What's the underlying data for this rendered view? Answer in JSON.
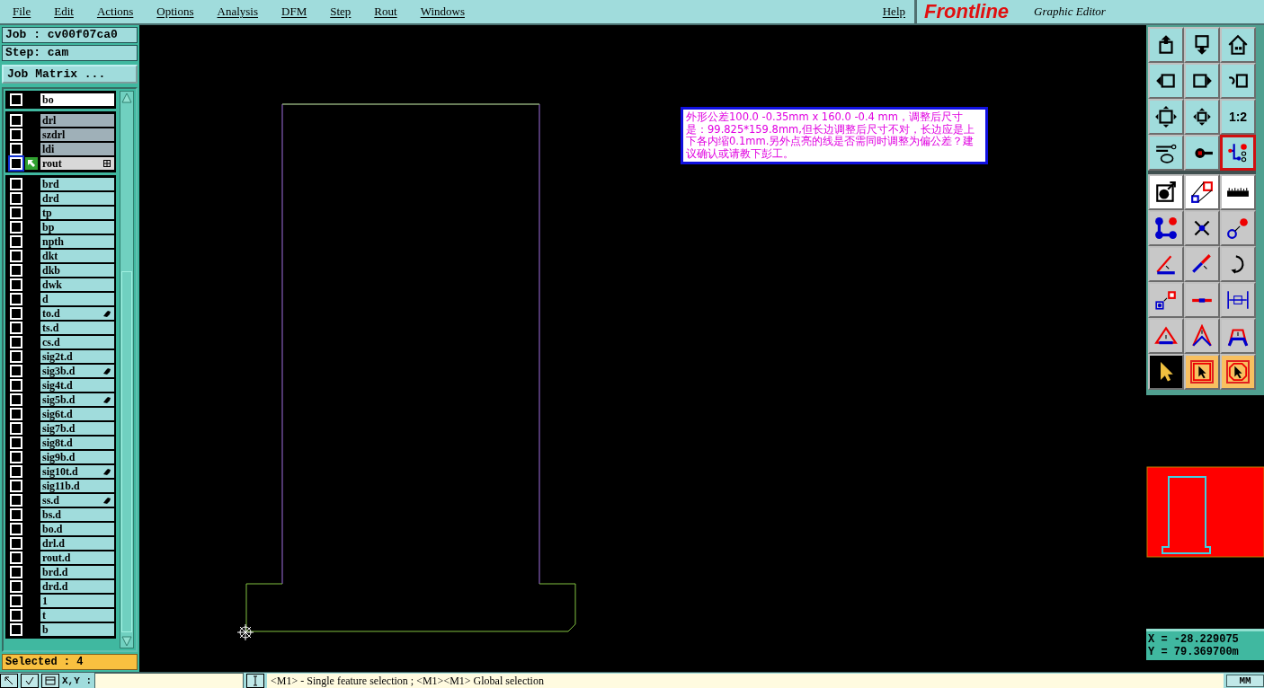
{
  "menu_bar": {
    "items": [
      {
        "label": "File"
      },
      {
        "label": "Edit"
      },
      {
        "label": "Actions"
      },
      {
        "label": "Options"
      },
      {
        "label": "Analysis"
      },
      {
        "label": "DFM"
      },
      {
        "label": "Step"
      },
      {
        "label": "Rout"
      },
      {
        "label": "Windows"
      }
    ],
    "help": "Help"
  },
  "logo": {
    "name": "Frontline",
    "subtitle": "Graphic Editor"
  },
  "job_panel": {
    "job": "Job : cv00f07ca0",
    "step": "Step: cam",
    "matrix_button": "Job Matrix ...",
    "selected_count": "Selected : 4",
    "layer_groups": [
      {
        "layers": [
          {
            "name": "bo",
            "color": "#ffffff",
            "active": false,
            "affected": false,
            "expandable": false
          }
        ]
      },
      {
        "layers": [
          {
            "name": "drl",
            "color": "#9fb0b8",
            "active": false,
            "affected": false,
            "expandable": false
          },
          {
            "name": "szdrl",
            "color": "#9fb0b8",
            "active": false,
            "affected": false,
            "expandable": false
          },
          {
            "name": "ldi",
            "color": "#9fb0b8",
            "active": false,
            "affected": false,
            "expandable": false
          },
          {
            "name": "rout",
            "color": "#d8d8d8",
            "active": true,
            "affected": false,
            "expandable": true
          }
        ]
      },
      {
        "layers": [
          {
            "name": "brd",
            "color": "#a0dcdc",
            "active": false,
            "affected": false,
            "expandable": false
          },
          {
            "name": "drd",
            "color": "#a0dcdc",
            "active": false,
            "affected": false,
            "expandable": false
          },
          {
            "name": "tp",
            "color": "#a0dcdc",
            "active": false,
            "affected": false,
            "expandable": false
          },
          {
            "name": "bp",
            "color": "#a0dcdc",
            "active": false,
            "affected": false,
            "expandable": false
          },
          {
            "name": "npth",
            "color": "#a0dcdc",
            "active": false,
            "affected": false,
            "expandable": false
          },
          {
            "name": "dkt",
            "color": "#a0dcdc",
            "active": false,
            "affected": false,
            "expandable": false
          },
          {
            "name": "dkb",
            "color": "#a0dcdc",
            "active": false,
            "affected": false,
            "expandable": false
          },
          {
            "name": "dwk",
            "color": "#a0dcdc",
            "active": false,
            "affected": false,
            "expandable": false
          },
          {
            "name": "d",
            "color": "#a0dcdc",
            "active": false,
            "affected": false,
            "expandable": false
          },
          {
            "name": "to.d",
            "color": "#a0dcdc",
            "active": false,
            "affected": true,
            "expandable": false
          },
          {
            "name": "ts.d",
            "color": "#a0dcdc",
            "active": false,
            "affected": false,
            "expandable": false
          },
          {
            "name": "cs.d",
            "color": "#a0dcdc",
            "active": false,
            "affected": false,
            "expandable": false
          },
          {
            "name": "sig2t.d",
            "color": "#a0dcdc",
            "active": false,
            "affected": false,
            "expandable": false
          },
          {
            "name": "sig3b.d",
            "color": "#a0dcdc",
            "active": false,
            "affected": true,
            "expandable": false
          },
          {
            "name": "sig4t.d",
            "color": "#a0dcdc",
            "active": false,
            "affected": false,
            "expandable": false
          },
          {
            "name": "sig5b.d",
            "color": "#a0dcdc",
            "active": false,
            "affected": true,
            "expandable": false
          },
          {
            "name": "sig6t.d",
            "color": "#a0dcdc",
            "active": false,
            "affected": false,
            "expandable": false
          },
          {
            "name": "sig7b.d",
            "color": "#a0dcdc",
            "active": false,
            "affected": false,
            "expandable": false
          },
          {
            "name": "sig8t.d",
            "color": "#a0dcdc",
            "active": false,
            "affected": false,
            "expandable": false
          },
          {
            "name": "sig9b.d",
            "color": "#a0dcdc",
            "active": false,
            "affected": false,
            "expandable": false
          },
          {
            "name": "sig10t.d",
            "color": "#a0dcdc",
            "active": false,
            "affected": true,
            "expandable": false
          },
          {
            "name": "sig11b.d",
            "color": "#a0dcdc",
            "active": false,
            "affected": false,
            "expandable": false
          },
          {
            "name": "ss.d",
            "color": "#a0dcdc",
            "active": false,
            "affected": true,
            "expandable": false
          },
          {
            "name": "bs.d",
            "color": "#a0dcdc",
            "active": false,
            "affected": false,
            "expandable": false
          },
          {
            "name": "bo.d",
            "color": "#a0dcdc",
            "active": false,
            "affected": false,
            "expandable": false
          },
          {
            "name": "drl.d",
            "color": "#a0dcdc",
            "active": false,
            "affected": false,
            "expandable": false
          },
          {
            "name": "rout.d",
            "color": "#a0dcdc",
            "active": false,
            "affected": false,
            "expandable": false
          },
          {
            "name": "brd.d",
            "color": "#a0dcdc",
            "active": false,
            "affected": false,
            "expandable": false
          },
          {
            "name": "drd.d",
            "color": "#a0dcdc",
            "active": false,
            "affected": false,
            "expandable": false
          },
          {
            "name": "1",
            "color": "#a0dcdc",
            "active": false,
            "affected": false,
            "expandable": false
          },
          {
            "name": "t",
            "color": "#a0dcdc",
            "active": false,
            "affected": false,
            "expandable": false
          },
          {
            "name": "b",
            "color": "#a0dcdc",
            "active": false,
            "affected": false,
            "expandable": false
          }
        ]
      }
    ]
  },
  "canvas": {
    "note": "外形公差100.0 -0.35mm x 160.0 -0.4 mm，调整后尺寸是：99.825*159.8mm,但长边调整后尺寸不对，长边应是上下各内缩0.1mm.另外点亮的线是否需同时调整为偏公差？建议确认或请教下彭工。"
  },
  "toolbar": {
    "buttons": [
      {
        "kind": "view",
        "selected": false
      },
      {
        "kind": "view",
        "selected": false
      },
      {
        "kind": "view",
        "selected": false
      },
      {
        "kind": "view",
        "selected": false
      },
      {
        "kind": "view",
        "selected": false
      },
      {
        "kind": "view",
        "selected": false
      },
      {
        "kind": "view",
        "selected": false
      },
      {
        "kind": "view",
        "selected": false
      },
      {
        "kind": "view",
        "selected": false,
        "label": "1:2"
      },
      {
        "kind": "view",
        "selected": false
      },
      {
        "kind": "view",
        "selected": false
      },
      {
        "kind": "view",
        "selected": true
      },
      {
        "kind": "option",
        "selected": false
      },
      {
        "kind": "option",
        "selected": false
      },
      {
        "kind": "option",
        "selected": false
      },
      {
        "kind": "edit",
        "selected": false
      },
      {
        "kind": "edit",
        "selected": false
      },
      {
        "kind": "edit",
        "selected": false
      },
      {
        "kind": "edit",
        "selected": false
      },
      {
        "kind": "edit",
        "selected": false
      },
      {
        "kind": "edit",
        "selected": false
      },
      {
        "kind": "edit",
        "selected": false
      },
      {
        "kind": "edit",
        "selected": false
      },
      {
        "kind": "edit",
        "selected": false
      },
      {
        "kind": "edit",
        "selected": false
      },
      {
        "kind": "edit",
        "selected": false
      },
      {
        "kind": "edit",
        "selected": false
      },
      {
        "kind": "select",
        "selected": true
      },
      {
        "kind": "select",
        "selected": false
      },
      {
        "kind": "select",
        "selected": false
      }
    ]
  },
  "coordinates": {
    "x": "X = -28.229075",
    "y": "Y = 79.369700m"
  },
  "status_bar": {
    "xy_label": "X,Y :",
    "message": "<M1> - Single feature selection ; <M1><M1> Global selection",
    "units": "MM"
  }
}
